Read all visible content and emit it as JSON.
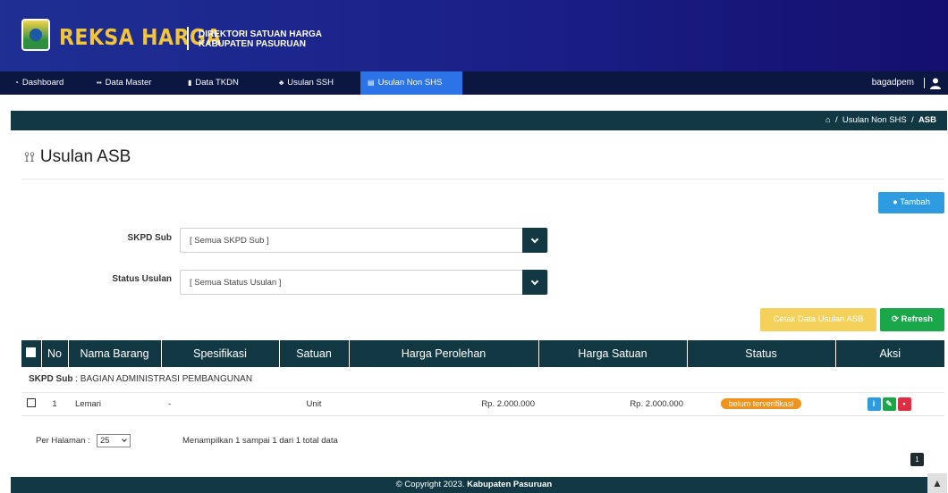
{
  "header": {
    "brand": "REKSA HARGA",
    "sub_line1": "DIREKTORI SATUAN HARGA",
    "sub_line2": "KABUPATEN PASURUAN"
  },
  "nav": {
    "items": [
      {
        "label": "Dashboard",
        "icon": "dashboard-icon"
      },
      {
        "label": "Data Master",
        "icon": "grid-icon"
      },
      {
        "label": "Data TKDN",
        "icon": "info-icon"
      },
      {
        "label": "Usulan SSH",
        "icon": "users-icon"
      },
      {
        "label": "Usulan Non SHS",
        "icon": "document-icon"
      }
    ],
    "active_index": 4,
    "user": "bagadpem"
  },
  "breadcrumb": {
    "home_icon": "home-icon",
    "parent": "Usulan Non SHS",
    "current": "ASB"
  },
  "page": {
    "title": "Usulan ASB",
    "tambah_label": "Tambah"
  },
  "filters": {
    "skpd_label": "SKPD Sub",
    "skpd_value": "[ Semua SKPD Sub ]",
    "status_label": "Status Usulan",
    "status_value": "[ Semua Status Usulan ]"
  },
  "actions": {
    "cetak_label": "Cetak Data Usulan ASB",
    "refresh_label": "Refresh"
  },
  "table": {
    "headers": [
      "No",
      "Nama Barang",
      "Spesifikasi",
      "Satuan",
      "Harga Perolehan",
      "Harga Satuan",
      "Status",
      "Aksi"
    ],
    "group_label": "SKPD Sub",
    "group_value": "BAGIAN ADMINISTRASI PEMBANGUNAN",
    "rows": [
      {
        "no": "1",
        "nama": "Lemari",
        "spesifikasi": "-",
        "satuan": "Unit",
        "harga_perolehan": "Rp. 2.000.000",
        "harga_satuan": "Rp. 2.000.000",
        "status": "belum terverifikasi"
      }
    ]
  },
  "pagination": {
    "per_page_label": "Per Halaman :",
    "per_page_value": "25",
    "showing": "Menampilkan 1 sampai 1 dari 1 total data",
    "page": "1"
  },
  "footer": {
    "copyright": "© Copyright 2023.",
    "org": "Kabupaten Pasuruan"
  },
  "colors": {
    "header_blue": "#1f2f93",
    "nav_dark": "#0b1740",
    "teal": "#123943",
    "accent_blue": "#2b73e6",
    "status_orange": "#f0931c",
    "refresh_green": "#19a74a",
    "cetak_yellow": "#f3d15a"
  }
}
